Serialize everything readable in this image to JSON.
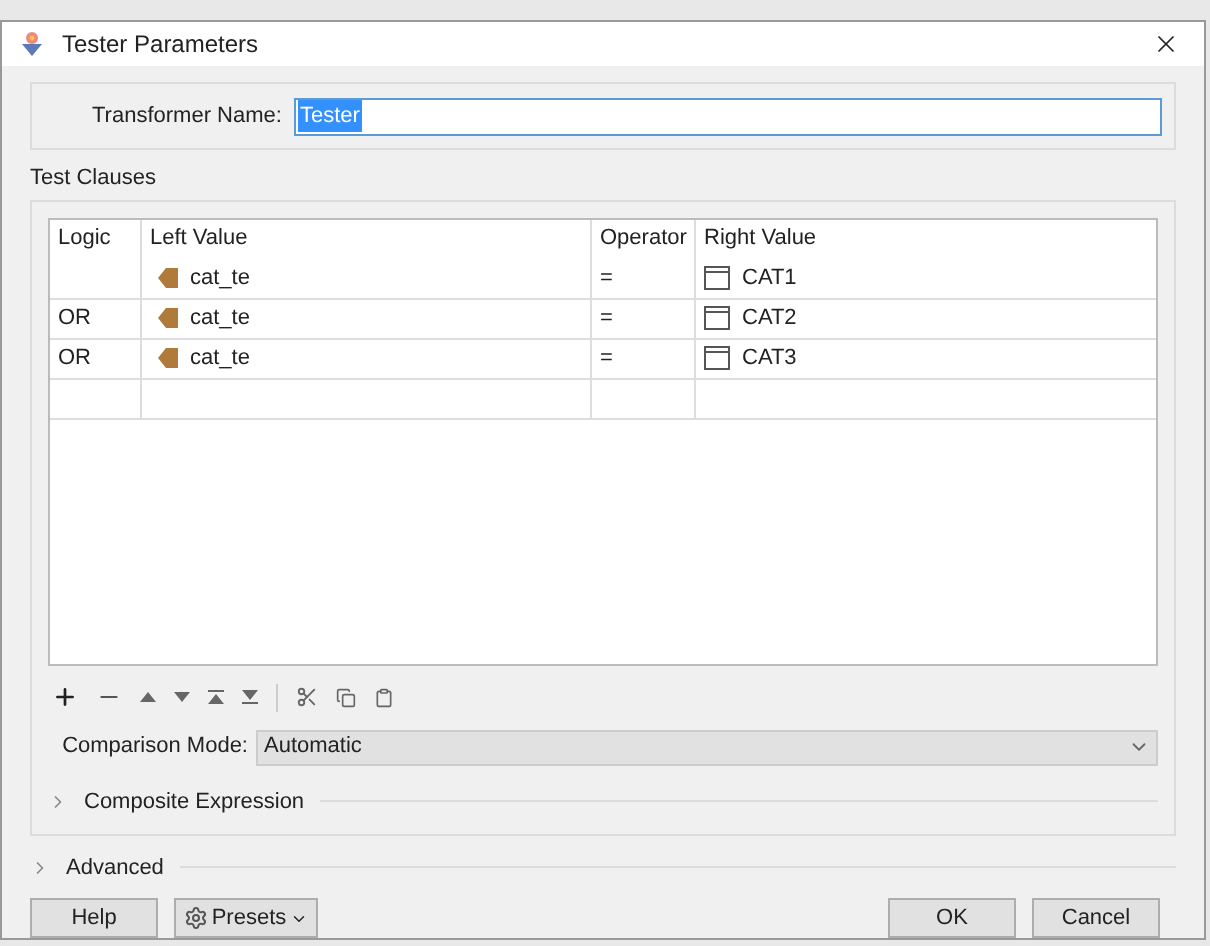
{
  "window": {
    "title": "Tester Parameters"
  },
  "transformer_name": {
    "label": "Transformer Name:",
    "value": "Tester",
    "selected": true
  },
  "test_clauses": {
    "title": "Test Clauses",
    "columns": [
      "Logic",
      "Left Value",
      "Operator",
      "Right Value"
    ],
    "rows": [
      {
        "logic": "",
        "left_value": "cat_te",
        "operator": "=",
        "right_value": "CAT1"
      },
      {
        "logic": "OR",
        "left_value": "cat_te",
        "operator": "=",
        "right_value": "CAT2"
      },
      {
        "logic": "OR",
        "left_value": "cat_te",
        "operator": "=",
        "right_value": "CAT3"
      }
    ],
    "comparison_mode": {
      "label": "Comparison Mode:",
      "value": "Automatic"
    },
    "composite_expression": {
      "label": "Composite Expression",
      "expanded": false
    }
  },
  "advanced": {
    "label": "Advanced",
    "expanded": false
  },
  "buttons": {
    "help": "Help",
    "presets": "Presets",
    "ok": "OK",
    "cancel": "Cancel"
  }
}
